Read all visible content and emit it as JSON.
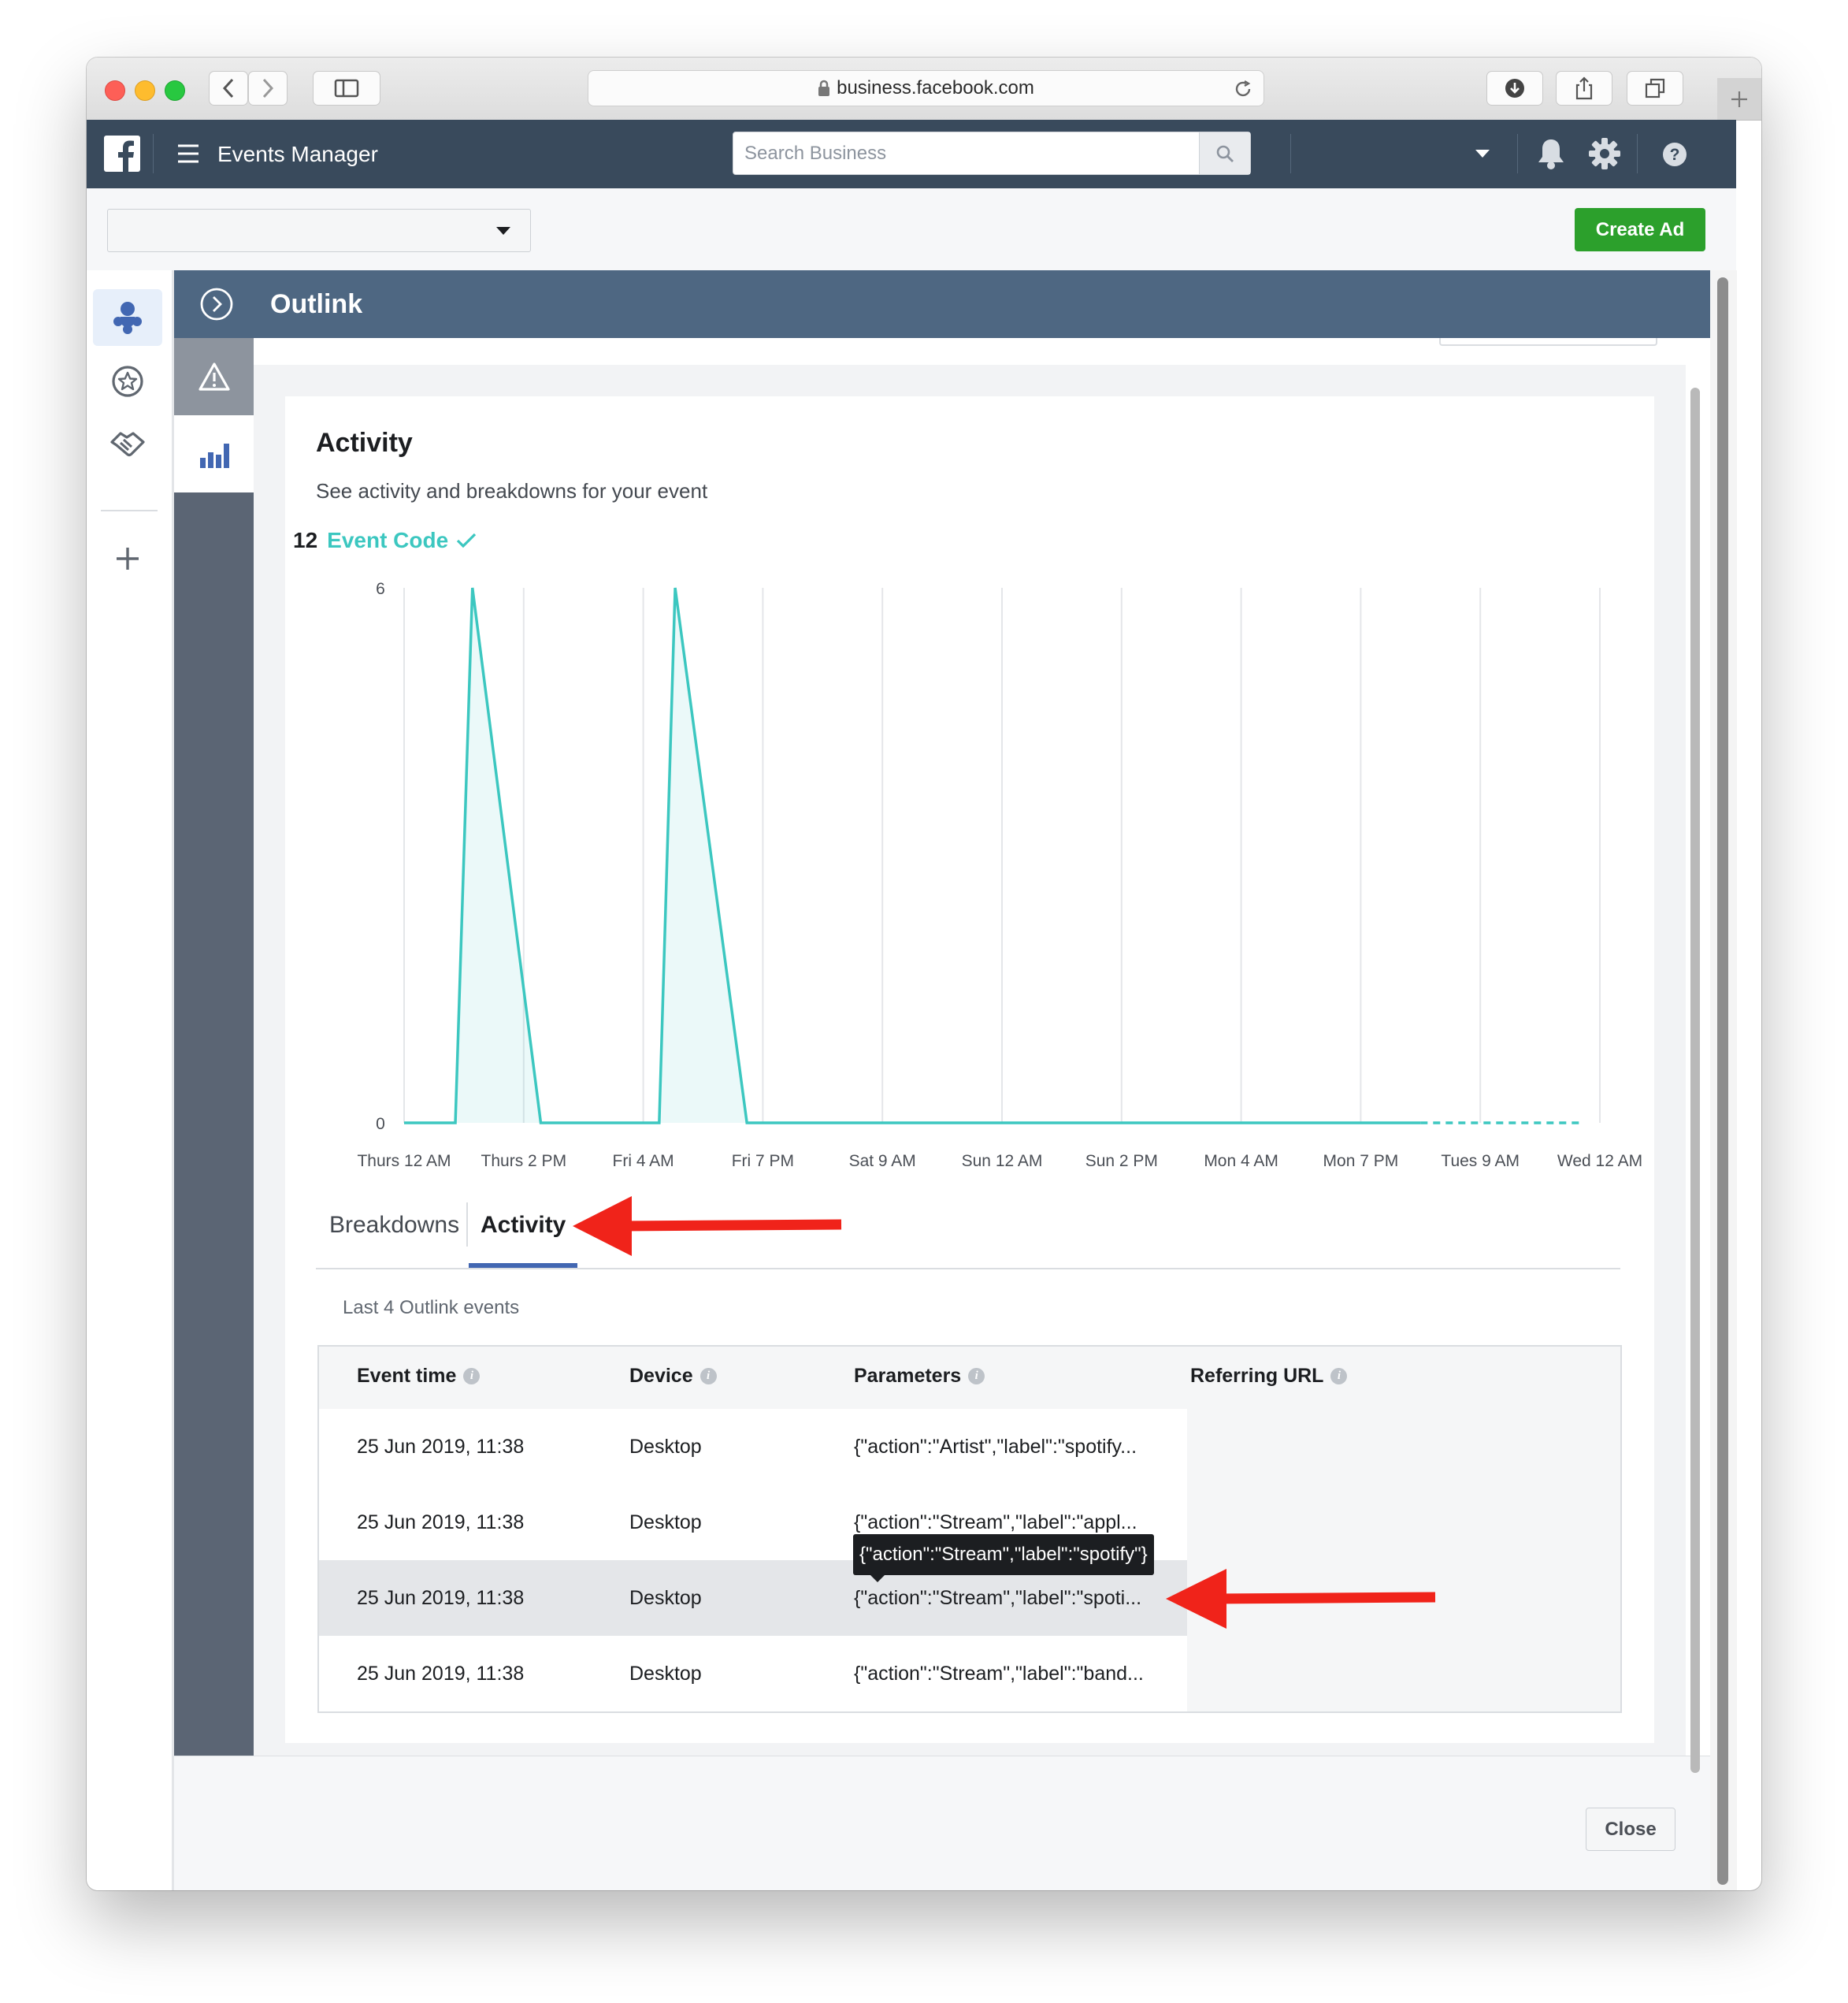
{
  "browser": {
    "url": "business.facebook.com",
    "icons": [
      "back-chevron-icon",
      "forward-chevron-icon",
      "sidebar-icon",
      "lock-icon",
      "reload-icon",
      "download-icon",
      "share-icon",
      "tabs-icon",
      "new-tab-plus-icon"
    ]
  },
  "header": {
    "app_title": "Events Manager",
    "search_placeholder": "Search Business",
    "icons": [
      "facebook-logo-icon",
      "hamburger-menu-icon",
      "search-icon",
      "dropdown-caret-icon",
      "bell-icon",
      "gear-icon",
      "help-icon"
    ]
  },
  "toolbar": {
    "select_value": "",
    "create_ad_label": "Create Ad"
  },
  "left_nav": {
    "icons": [
      "events-data-sources-icon",
      "star-badge-icon",
      "handshake-icon",
      "plus-icon"
    ]
  },
  "panel": {
    "title": "Outlink",
    "rail_icons": [
      "warning-triangle-icon",
      "bar-chart-icon"
    ],
    "activity_heading": "Activity",
    "activity_subtitle": "See activity and breakdowns for your event",
    "event_count": "12",
    "event_source_label": "Event Code",
    "tabs": [
      {
        "label": "Breakdowns",
        "active": false
      },
      {
        "label": "Activity",
        "active": true
      }
    ],
    "table_caption": "Last 4 Outlink events",
    "columns": [
      "Event time",
      "Device",
      "Parameters",
      "Referring URL"
    ],
    "rows": [
      {
        "time": "25 Jun 2019, 11:38",
        "device": "Desktop",
        "parameters": "{\"action\":\"Artist\",\"label\":\"spotify...",
        "url": ""
      },
      {
        "time": "25 Jun 2019, 11:38",
        "device": "Desktop",
        "parameters": "{\"action\":\"Stream\",\"label\":\"appl...",
        "url": ""
      },
      {
        "time": "25 Jun 2019, 11:38",
        "device": "Desktop",
        "parameters": "{\"action\":\"Stream\",\"label\":\"spoti...",
        "url": ""
      },
      {
        "time": "25 Jun 2019, 11:38",
        "device": "Desktop",
        "parameters": "{\"action\":\"Stream\",\"label\":\"band...",
        "url": ""
      }
    ],
    "tooltip": "{\"action\":\"Stream\",\"label\":\"spotify\"}",
    "close_label": "Close"
  },
  "colors": {
    "header_bg": "#394a5c",
    "panel_header_bg": "#4e6782",
    "accent_teal": "#3cc7c0",
    "create_ad_green": "#2ca02c",
    "tab_underline": "#4267b2",
    "annotation_arrow": "#f0231a"
  },
  "chart_data": {
    "type": "area",
    "x": [
      "Thurs 12 AM",
      "Thurs 2 PM",
      "Fri 4 AM",
      "Fri 7 PM",
      "Sat 9 AM",
      "Sun 12 AM",
      "Sun 2 PM",
      "Mon 4 AM",
      "Mon 7 PM",
      "Tues 9 AM",
      "Wed 12 AM"
    ],
    "ytick_labels": [
      "0",
      "6"
    ],
    "ylim": [
      0,
      6
    ],
    "grid": true,
    "series": [
      {
        "x": [
          "Thurs 12 AM",
          "Thurs 6 AM",
          "Thurs 8 AM",
          "Thurs 4 PM",
          "Fri 6 AM",
          "Fri 8 AM",
          "Fri 5 PM",
          "Tues 2 AM"
        ],
        "values": [
          0,
          0,
          6,
          0,
          0,
          6,
          0,
          0
        ]
      }
    ],
    "projected_segment": {
      "from": "Tues 2 AM",
      "to": "Tues 10 PM",
      "value": 0,
      "style": "dashed"
    }
  }
}
